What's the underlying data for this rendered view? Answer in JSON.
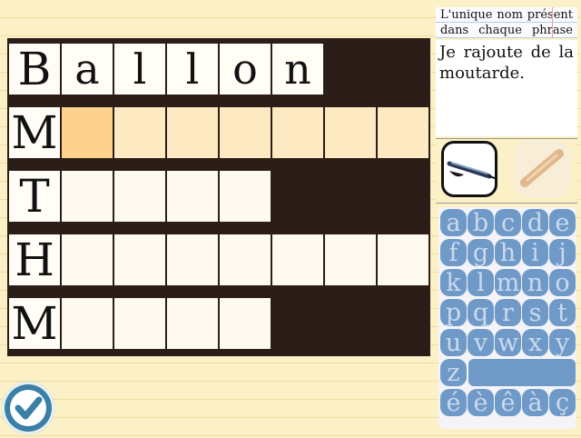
{
  "board": {
    "rows": [
      {
        "head": "B",
        "letters": [
          "a",
          "l",
          "l",
          "o",
          "n"
        ],
        "empty_count": 0
      },
      {
        "head": "M",
        "letters": [],
        "empty_count": 7,
        "highlighted": true,
        "active_index": 0
      },
      {
        "head": "T",
        "letters": [],
        "empty_count": 4
      },
      {
        "head": "H",
        "letters": [],
        "empty_count": 7
      },
      {
        "head": "M",
        "letters": [],
        "empty_count": 4
      }
    ]
  },
  "panel": {
    "instruction": "L'unique nom présent dans chaque phrase",
    "sentence": "Je rajoute de la moutarde.",
    "tools": [
      {
        "name": "pen-tool",
        "selected": true
      },
      {
        "name": "pencil-tool",
        "selected": false
      }
    ]
  },
  "keyboard": {
    "rows": [
      [
        "a",
        "b",
        "c",
        "d",
        "e"
      ],
      [
        "f",
        "g",
        "h",
        "i",
        "j"
      ],
      [
        "k",
        "l",
        "m",
        "n",
        "o"
      ],
      [
        "p",
        "q",
        "r",
        "s",
        "t"
      ],
      [
        "u",
        "v",
        "w",
        "x",
        "y"
      ],
      [
        "z"
      ],
      [
        "é",
        "è",
        "ê",
        "à",
        "ç"
      ]
    ]
  },
  "colors": {
    "board_bg": "#2b1d18",
    "highlight": "#fde9c2",
    "active": "#fdd28d",
    "key": "#6f99c7"
  },
  "validate": {
    "icon": "check-icon"
  }
}
